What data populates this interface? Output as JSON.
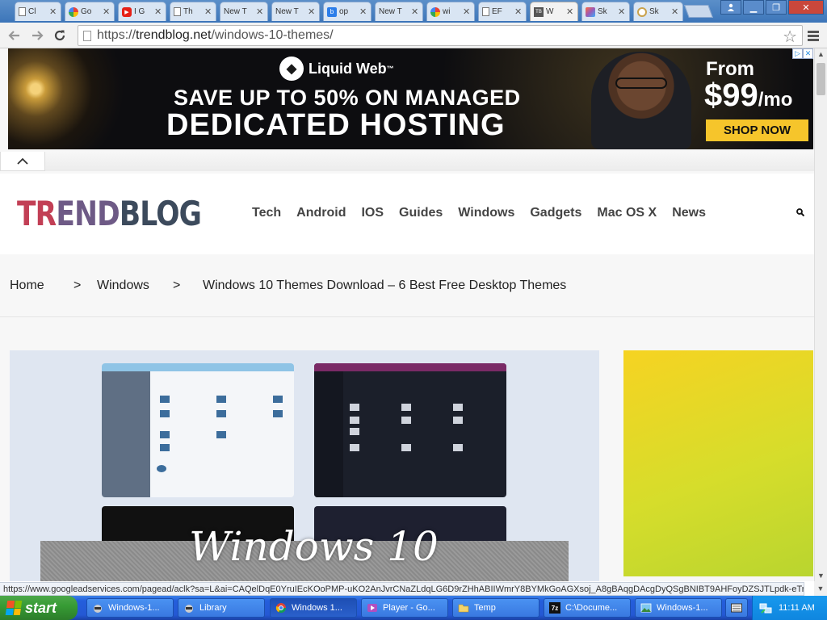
{
  "browser": {
    "tabs": [
      {
        "label": "Cl",
        "icon": "doc-icon"
      },
      {
        "label": "Go",
        "icon": "google-icon"
      },
      {
        "label": "I G",
        "icon": "youtube-icon"
      },
      {
        "label": "Th",
        "icon": "doc-icon"
      },
      {
        "label": "New T",
        "icon": "none"
      },
      {
        "label": "New T",
        "icon": "none"
      },
      {
        "label": "op",
        "icon": "bing-icon"
      },
      {
        "label": "New T",
        "icon": "none"
      },
      {
        "label": "wi",
        "icon": "google-icon"
      },
      {
        "label": "EF",
        "icon": "doc-icon"
      },
      {
        "label": "W",
        "icon": "trendblog-icon"
      },
      {
        "label": "Sk",
        "icon": "sketch-icon"
      },
      {
        "label": "Sk",
        "icon": "spiral-icon"
      }
    ],
    "active_tab_index": 10,
    "url_prefix": "https://",
    "url_host": "trendblog.net",
    "url_path": "/windows-10-themes/",
    "status_url": "https://www.googleadservices.com/pagead/aclk?sa=L&ai=CAQelDqE0YruIEcKOoPMP-uKO2AnJvrCNaZLdqLG6D9rZHhABIIWmrY8BYMkGoAGXsoj_A8gBAqgDAcgDyQSgBNIBT9AHFoyDZSJTLpdk-eTr8ajtmHA...",
    "colors": {
      "chrome_frame": "#3c75b9",
      "tab_active": "#f2f2f2"
    }
  },
  "ad_banner": {
    "brand": "Liquid Web",
    "brand_mark": "™",
    "headline_1": "SAVE UP TO 50% ON MANAGED",
    "headline_2": "DEDICATED HOSTING",
    "from": "From",
    "price": "$99",
    "price_unit": "/mo",
    "cta": "SHOP NOW",
    "adchoices": "▷",
    "close": "✕",
    "colors": {
      "cta_bg": "#f6c52b",
      "bg": "#0d0d10"
    }
  },
  "site": {
    "logo_part1": "TR",
    "logo_part2": "END",
    "logo_part3": "BLOG",
    "nav": [
      "Tech",
      "Android",
      "IOS",
      "Guides",
      "Windows",
      "Gadgets",
      "Mac OS X",
      "News"
    ],
    "colors": {
      "logo_red": "#c23f55",
      "logo_purple": "#6e5a86",
      "logo_dark": "#3c4a5c"
    }
  },
  "breadcrumb": {
    "home": "Home",
    "sep": ">",
    "category": "Windows",
    "current": "Windows 10 Themes Download – 6 Best Free Desktop Themes"
  },
  "hero": {
    "title": "Windows 10"
  },
  "taskbar": {
    "start_label": "start",
    "items": [
      {
        "label": "Windows-1...",
        "icon": "raccoon-icon"
      },
      {
        "label": "Library",
        "icon": "raccoon-icon"
      },
      {
        "label": "Windows 1...",
        "icon": "chrome-icon"
      },
      {
        "label": "Player - Go...",
        "icon": "player-icon"
      },
      {
        "label": "Temp",
        "icon": "folder-icon"
      },
      {
        "label": "C:\\Docume...",
        "icon": "7zip-icon"
      },
      {
        "label": "Windows-1...",
        "icon": "image-viewer-icon"
      }
    ],
    "active_index": 2,
    "clock": "11:11 AM",
    "colors": {
      "bar": "#245edc",
      "start": "#379c35",
      "tray": "#0f86df"
    }
  }
}
